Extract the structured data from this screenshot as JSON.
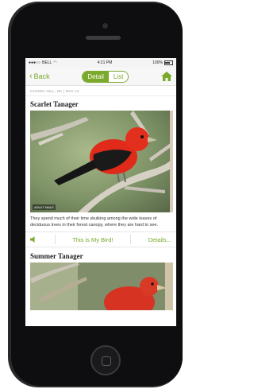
{
  "status_bar": {
    "carrier": "BELL",
    "time": "4:21 PM",
    "battery": "100%"
  },
  "nav": {
    "back_label": "Back",
    "tabs": [
      {
        "label": "Detail",
        "active": true
      },
      {
        "label": "List",
        "active": false
      }
    ],
    "home_icon": "home-icon"
  },
  "location": "CHAPEL HILL, NC | MAY 12",
  "birds": [
    {
      "name": "Scarlet Tanager",
      "photo_tag": "ADULT MALE",
      "description": "They spend much of their time skulking among the wide leaves of deciduous trees in their forest canopy, where they are hard to see."
    },
    {
      "name": "Summer Tanager"
    }
  ],
  "actions": {
    "speaker_icon": "speaker-icon",
    "this_is_my_bird": "This is My Bird!",
    "details": "Details..."
  },
  "colors": {
    "accent": "#7aa92b",
    "bird_red": "#e02a1a",
    "bird_black": "#1a1a1a"
  }
}
